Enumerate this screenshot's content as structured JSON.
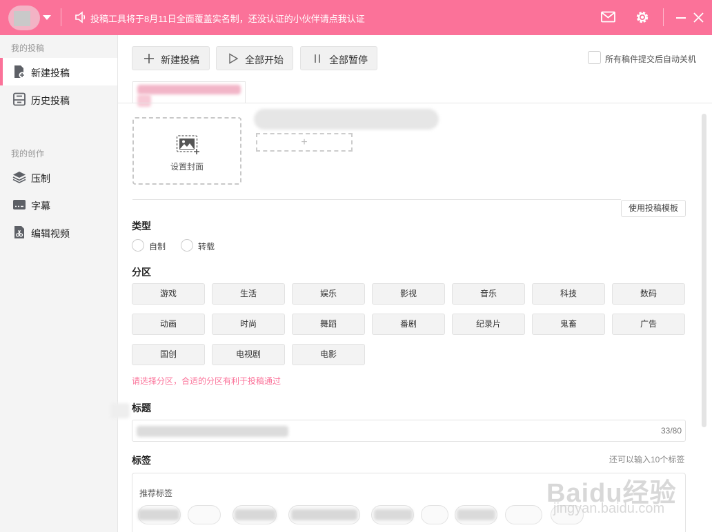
{
  "topbar": {
    "notice": "投稿工具将于8月11日全面覆盖实名制，还没认证的小伙伴请点我认证",
    "icons": [
      "mail-icon",
      "gear-icon",
      "minimize-icon",
      "close-icon"
    ]
  },
  "sidebar": {
    "section1": "我的投稿",
    "new_post": "新建投稿",
    "history": "历史投稿",
    "section2": "我的创作",
    "compress": "压制",
    "subtitle": "字幕",
    "edit_video": "编辑视频"
  },
  "toolbar": {
    "new_label": "新建投稿",
    "start_all": "全部开始",
    "pause_all": "全部暂停",
    "auto_shutdown": "所有稿件提交后自动关机"
  },
  "upload": {
    "cover_label": "设置封面",
    "add_symbol": "+",
    "template_button": "使用投稿模板"
  },
  "type": {
    "heading": "类型",
    "options": [
      "自制",
      "转载"
    ]
  },
  "category": {
    "heading": "分区",
    "items": [
      "游戏",
      "生活",
      "娱乐",
      "影视",
      "音乐",
      "科技",
      "数码",
      "动画",
      "时尚",
      "舞蹈",
      "番剧",
      "纪录片",
      "鬼畜",
      "广告",
      "国创",
      "电视剧",
      "电影"
    ],
    "hint": "请选择分区，合适的分区有利于投稿通过"
  },
  "title": {
    "heading": "标题",
    "counter": "33/80"
  },
  "tags": {
    "heading": "标签",
    "note": "还可以输入10个标签",
    "recommend_label": "推荐标签"
  },
  "watermark": {
    "brand": "Baidu经验",
    "url": "jingyan.baidu.com"
  },
  "colors": {
    "accent": "#fb7299",
    "hint": "#fb7299"
  }
}
